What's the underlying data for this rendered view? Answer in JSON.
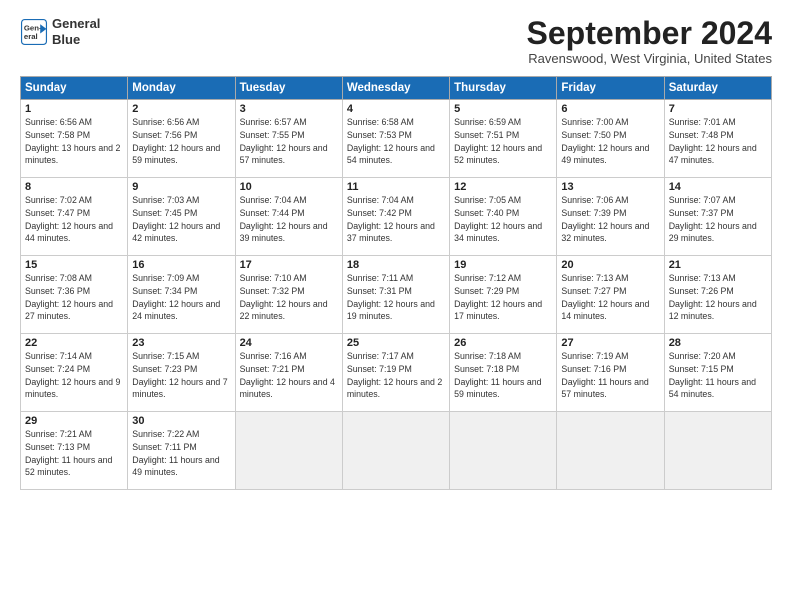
{
  "header": {
    "logo_line1": "General",
    "logo_line2": "Blue",
    "title": "September 2024",
    "location": "Ravenswood, West Virginia, United States"
  },
  "weekdays": [
    "Sunday",
    "Monday",
    "Tuesday",
    "Wednesday",
    "Thursday",
    "Friday",
    "Saturday"
  ],
  "weeks": [
    [
      {
        "day": "1",
        "sunrise": "6:56 AM",
        "sunset": "7:58 PM",
        "daylight": "13 hours and 2 minutes."
      },
      {
        "day": "2",
        "sunrise": "6:56 AM",
        "sunset": "7:56 PM",
        "daylight": "12 hours and 59 minutes."
      },
      {
        "day": "3",
        "sunrise": "6:57 AM",
        "sunset": "7:55 PM",
        "daylight": "12 hours and 57 minutes."
      },
      {
        "day": "4",
        "sunrise": "6:58 AM",
        "sunset": "7:53 PM",
        "daylight": "12 hours and 54 minutes."
      },
      {
        "day": "5",
        "sunrise": "6:59 AM",
        "sunset": "7:51 PM",
        "daylight": "12 hours and 52 minutes."
      },
      {
        "day": "6",
        "sunrise": "7:00 AM",
        "sunset": "7:50 PM",
        "daylight": "12 hours and 49 minutes."
      },
      {
        "day": "7",
        "sunrise": "7:01 AM",
        "sunset": "7:48 PM",
        "daylight": "12 hours and 47 minutes."
      }
    ],
    [
      {
        "day": "8",
        "sunrise": "7:02 AM",
        "sunset": "7:47 PM",
        "daylight": "12 hours and 44 minutes."
      },
      {
        "day": "9",
        "sunrise": "7:03 AM",
        "sunset": "7:45 PM",
        "daylight": "12 hours and 42 minutes."
      },
      {
        "day": "10",
        "sunrise": "7:04 AM",
        "sunset": "7:44 PM",
        "daylight": "12 hours and 39 minutes."
      },
      {
        "day": "11",
        "sunrise": "7:04 AM",
        "sunset": "7:42 PM",
        "daylight": "12 hours and 37 minutes."
      },
      {
        "day": "12",
        "sunrise": "7:05 AM",
        "sunset": "7:40 PM",
        "daylight": "12 hours and 34 minutes."
      },
      {
        "day": "13",
        "sunrise": "7:06 AM",
        "sunset": "7:39 PM",
        "daylight": "12 hours and 32 minutes."
      },
      {
        "day": "14",
        "sunrise": "7:07 AM",
        "sunset": "7:37 PM",
        "daylight": "12 hours and 29 minutes."
      }
    ],
    [
      {
        "day": "15",
        "sunrise": "7:08 AM",
        "sunset": "7:36 PM",
        "daylight": "12 hours and 27 minutes."
      },
      {
        "day": "16",
        "sunrise": "7:09 AM",
        "sunset": "7:34 PM",
        "daylight": "12 hours and 24 minutes."
      },
      {
        "day": "17",
        "sunrise": "7:10 AM",
        "sunset": "7:32 PM",
        "daylight": "12 hours and 22 minutes."
      },
      {
        "day": "18",
        "sunrise": "7:11 AM",
        "sunset": "7:31 PM",
        "daylight": "12 hours and 19 minutes."
      },
      {
        "day": "19",
        "sunrise": "7:12 AM",
        "sunset": "7:29 PM",
        "daylight": "12 hours and 17 minutes."
      },
      {
        "day": "20",
        "sunrise": "7:13 AM",
        "sunset": "7:27 PM",
        "daylight": "12 hours and 14 minutes."
      },
      {
        "day": "21",
        "sunrise": "7:13 AM",
        "sunset": "7:26 PM",
        "daylight": "12 hours and 12 minutes."
      }
    ],
    [
      {
        "day": "22",
        "sunrise": "7:14 AM",
        "sunset": "7:24 PM",
        "daylight": "12 hours and 9 minutes."
      },
      {
        "day": "23",
        "sunrise": "7:15 AM",
        "sunset": "7:23 PM",
        "daylight": "12 hours and 7 minutes."
      },
      {
        "day": "24",
        "sunrise": "7:16 AM",
        "sunset": "7:21 PM",
        "daylight": "12 hours and 4 minutes."
      },
      {
        "day": "25",
        "sunrise": "7:17 AM",
        "sunset": "7:19 PM",
        "daylight": "12 hours and 2 minutes."
      },
      {
        "day": "26",
        "sunrise": "7:18 AM",
        "sunset": "7:18 PM",
        "daylight": "11 hours and 59 minutes."
      },
      {
        "day": "27",
        "sunrise": "7:19 AM",
        "sunset": "7:16 PM",
        "daylight": "11 hours and 57 minutes."
      },
      {
        "day": "28",
        "sunrise": "7:20 AM",
        "sunset": "7:15 PM",
        "daylight": "11 hours and 54 minutes."
      }
    ],
    [
      {
        "day": "29",
        "sunrise": "7:21 AM",
        "sunset": "7:13 PM",
        "daylight": "11 hours and 52 minutes."
      },
      {
        "day": "30",
        "sunrise": "7:22 AM",
        "sunset": "7:11 PM",
        "daylight": "11 hours and 49 minutes."
      },
      null,
      null,
      null,
      null,
      null
    ]
  ]
}
